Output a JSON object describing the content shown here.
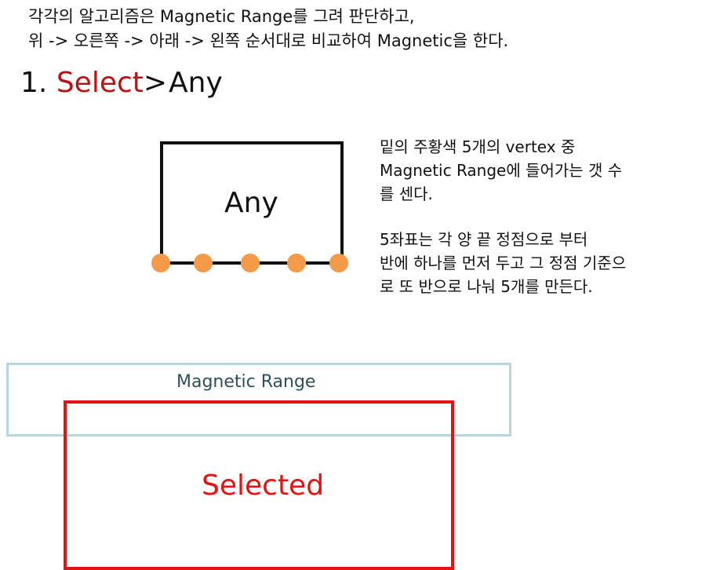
{
  "intro": {
    "line1": "각각의 알고리즘은 Magnetic Range를 그려 판단하고,",
    "line2": "위 -> 오른쪽 -> 아래 -> 왼쪽 순서대로 비교하여 Magnetic을 한다."
  },
  "heading": {
    "number": "1.",
    "select": "Select",
    "chevron": ">",
    "target": "Any"
  },
  "diagram": {
    "box_label": "Any",
    "vertex_color": "#f49b4a",
    "vertex_count": 5
  },
  "description": {
    "para1": [
      "밑의 주황색 5개의 vertex 중",
      "Magnetic Range에 들어가는 갯 수",
      "를 센다."
    ],
    "para2": [
      "5좌표는 각 양 끝 정점으로 부터",
      "반에 하나를 먼저 두고 그 정점 기준으",
      "로 또 반으로 나눠 5개를 만든다."
    ]
  },
  "range": {
    "label": "Magnetic Range",
    "border_color": "#b5d7e2"
  },
  "selected": {
    "label": "Selected",
    "color": "#e51212"
  }
}
